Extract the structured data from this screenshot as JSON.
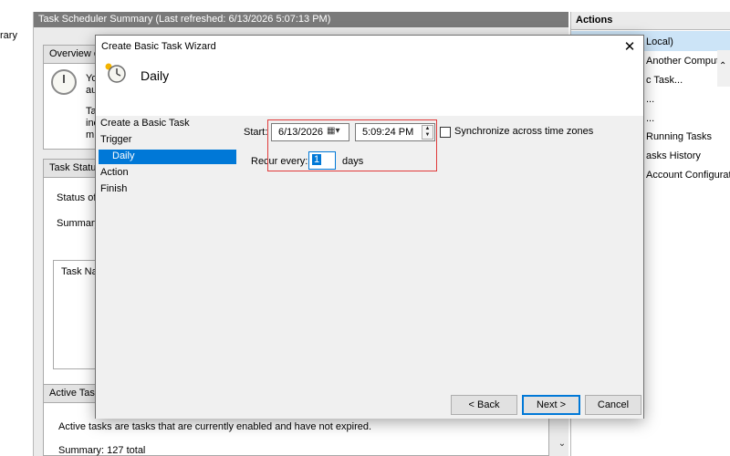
{
  "background": {
    "tree_label": "rary",
    "summary_header": "Task Scheduler Summary (Last refreshed: 6/13/2026 5:07:13 PM)",
    "overview_head": "Overview o",
    "overview_lines": [
      "Yo",
      "au",
      "Ta",
      "inc",
      "m"
    ],
    "status_head": "Task Status",
    "status_of": "Status of",
    "summary": "Summary",
    "task_name": "Task Nar",
    "active_head": "Active Task",
    "active_text": "Active tasks are tasks that are currently enabled and have not expired.",
    "active_summary": "Summary: 127 total",
    "scroll_down": "⌄"
  },
  "actions": {
    "header": "Actions",
    "items": [
      "Local)",
      "Another Computer...",
      "c Task...",
      "...",
      "...",
      "Running Tasks",
      "asks History",
      "Account Configuration"
    ],
    "scroll_up": "⌃"
  },
  "dialog": {
    "title": "Create Basic Task Wizard",
    "close": "✕",
    "heading": "Daily",
    "steps": [
      "Create a Basic Task",
      "Trigger",
      "Daily",
      "Action",
      "Finish"
    ],
    "start_label": "Start:",
    "start_date": "6/13/2026",
    "calendar_glyph": "▦▾",
    "start_time": "5:09:24 PM",
    "spin_up": "▲",
    "spin_down": "▼",
    "sync_label": "Synchronize across time zones",
    "recur_label": "Recur every:",
    "recur_value": "1",
    "recur_unit": "days",
    "back": "< Back",
    "next": "Next >",
    "cancel": "Cancel"
  }
}
